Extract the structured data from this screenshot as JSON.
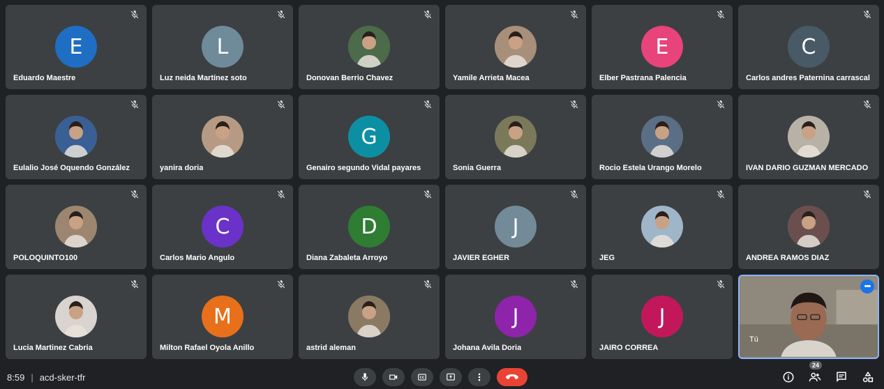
{
  "participants": [
    {
      "name": "Eduardo Maestre",
      "initial": "E",
      "color": "#1e6ec3",
      "photo": false
    },
    {
      "name": "Luz neida Martínez soto",
      "initial": "L",
      "color": "#6f8a98",
      "photo": false
    },
    {
      "name": "Donovan Berrio Chavez",
      "initial": "",
      "color": "#4b6b4a",
      "photo": true
    },
    {
      "name": "Yamile Arrieta Macea",
      "initial": "",
      "color": "#a88f7a",
      "photo": true
    },
    {
      "name": "Elber Pastrana Palencia",
      "initial": "E",
      "color": "#e8437a",
      "photo": false
    },
    {
      "name": "Carlos andres Paternina carrascal",
      "initial": "C",
      "color": "#485a66",
      "photo": false
    },
    {
      "name": "Eulalio José Oquendo González",
      "initial": "",
      "color": "#3a5f94",
      "photo": true
    },
    {
      "name": "yanira doria",
      "initial": "",
      "color": "#b79a83",
      "photo": true
    },
    {
      "name": "Genairo segundo Vidal payares",
      "initial": "G",
      "color": "#0d8fa3",
      "photo": false
    },
    {
      "name": "Sonia Guerra",
      "initial": "",
      "color": "#7a7a5a",
      "photo": true
    },
    {
      "name": "Rocio Estela Urango Morelo",
      "initial": "",
      "color": "#5a6e86",
      "photo": true
    },
    {
      "name": "IVAN DARIO GUZMAN MERCADO",
      "initial": "",
      "color": "#b8b2a6",
      "photo": true
    },
    {
      "name": "POLOQUINTO100",
      "initial": "",
      "color": "#9c8670",
      "photo": true
    },
    {
      "name": "Carlos Mario Angulo",
      "initial": "C",
      "color": "#6a32c9",
      "photo": false
    },
    {
      "name": "Diana Zabaleta Arroyo",
      "initial": "D",
      "color": "#2e7d32",
      "photo": false
    },
    {
      "name": "JAVIER EGHER",
      "initial": "J",
      "color": "#738a98",
      "photo": false
    },
    {
      "name": "JEG",
      "initial": "",
      "color": "#9fb6c9",
      "photo": true
    },
    {
      "name": "ANDREA RAMOS DIAZ",
      "initial": "",
      "color": "#6b4f4f",
      "photo": true
    },
    {
      "name": "Lucia Martinez Cabria",
      "initial": "",
      "color": "#d9d4cf",
      "photo": true
    },
    {
      "name": "Milton Rafael Oyola Anillo",
      "initial": "M",
      "color": "#e8701a",
      "photo": false
    },
    {
      "name": "astrid aleman",
      "initial": "",
      "color": "#8a7a64",
      "photo": true
    },
    {
      "name": "Johana Avila Doria",
      "initial": "J",
      "color": "#8e24aa",
      "photo": false
    },
    {
      "name": "JAIRO CORREA",
      "initial": "J",
      "color": "#c2185b",
      "photo": false
    }
  ],
  "self": {
    "label": "Tú"
  },
  "meeting": {
    "time": "8:59",
    "code": "acd-sker-tfr"
  },
  "participant_count": "24",
  "icons": {
    "mute": "mic-off-icon",
    "mic": "mic-icon",
    "camera": "camera-icon",
    "captions": "captions-icon",
    "present": "present-icon",
    "more": "more-vert-icon",
    "end": "end-call-icon",
    "info": "info-icon",
    "people": "people-icon",
    "chat": "chat-icon",
    "activities": "activities-icon"
  }
}
